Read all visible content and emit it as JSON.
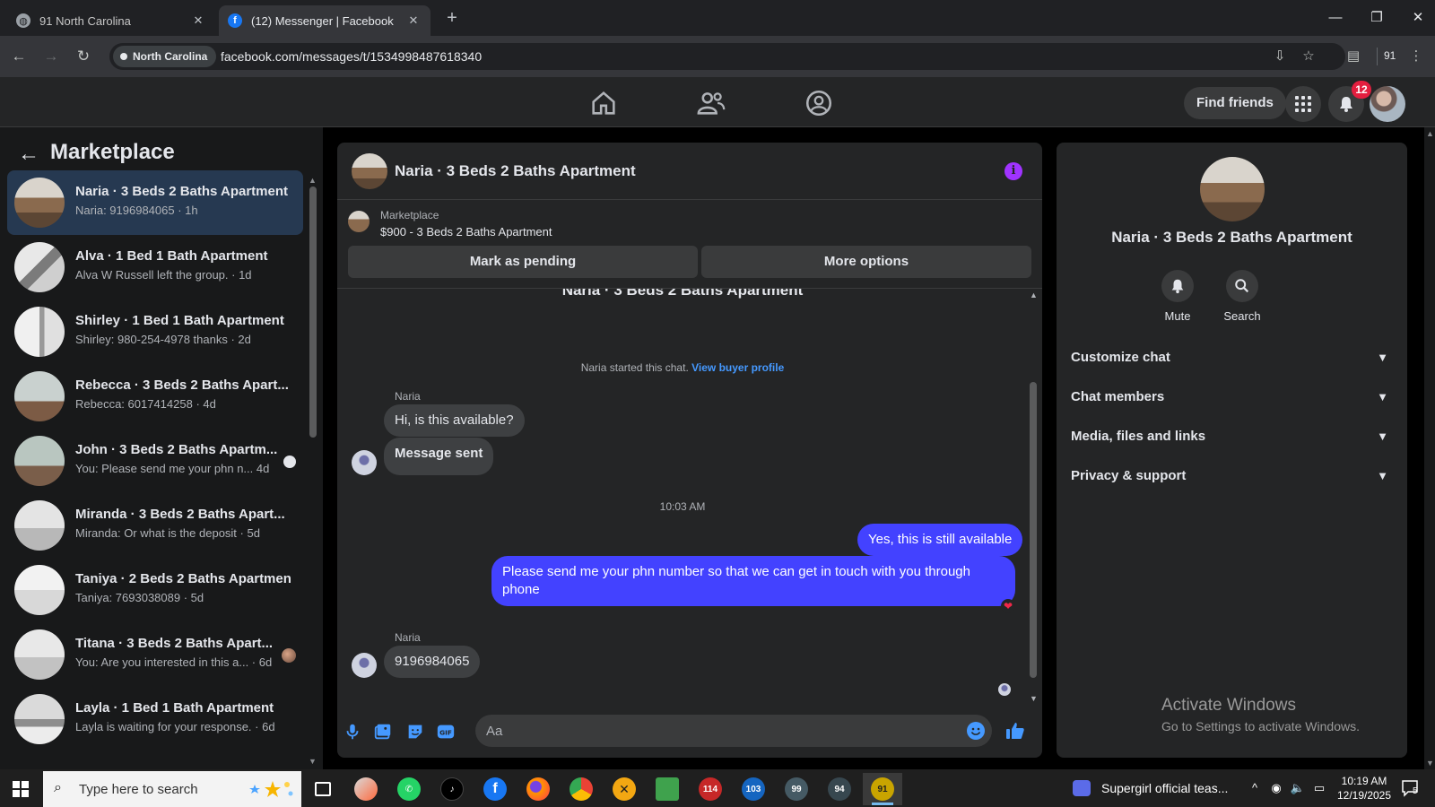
{
  "browser": {
    "tabs": [
      {
        "title": "91 North Carolina",
        "favicon": "globe-icon",
        "active": false
      },
      {
        "title": "(12) Messenger | Facebook",
        "favicon": "facebook-icon",
        "active": true
      }
    ],
    "profile_chip": "North Carolina",
    "url": "facebook.com/messages/t/1534998487618340",
    "toolbar_count": "91"
  },
  "header": {
    "find_friends": "Find friends",
    "notification_count": "12"
  },
  "marketplace": {
    "title": "Marketplace",
    "chats": [
      {
        "name": "Naria · 3 Beds 2 Baths Apartment",
        "preview": "Naria: 9196984065 · 1h",
        "active": true
      },
      {
        "name": "Alva · 1 Bed 1 Bath Apartment",
        "preview": "Alva W Russell left the group. · 1d"
      },
      {
        "name": "Shirley · 1 Bed 1 Bath Apartment",
        "preview": "Shirley: 980-254-4978 thanks · 2d"
      },
      {
        "name": "Rebecca · 3 Beds 2 Baths Apart...",
        "preview": "Rebecca: 6017414258 · 4d"
      },
      {
        "name": "John · 3 Beds 2 Baths Apartm...",
        "preview": "You: Please send me your phn n...   4d",
        "read_indicator": "white"
      },
      {
        "name": "Miranda · 3 Beds 2 Baths Apart...",
        "preview": "Miranda: Or what is the deposit · 5d"
      },
      {
        "name": "Taniya · 2 Beds 2 Baths Apartment",
        "preview": "Taniya: 7693038089 · 5d"
      },
      {
        "name": "Titana · 3 Beds 2 Baths Apart...",
        "preview": "You: Are you interested in this a...  · 6d",
        "read_indicator": "avatar"
      },
      {
        "name": "Layla · 1 Bed 1 Bath Apartment",
        "preview": "Layla is waiting for your response. · 6d"
      }
    ]
  },
  "conversation": {
    "title": "Naria · 3 Beds 2 Baths Apartment",
    "marketplace_label": "Marketplace",
    "listing": "$900 - 3 Beds 2 Baths Apartment",
    "buttons": {
      "pending": "Mark as pending",
      "more": "More options"
    },
    "cut_title": "Naria · 3 Beds 2 Baths Apartment",
    "system_message": "Naria started this chat.",
    "system_link": "View buyer profile",
    "sender": "Naria",
    "messages": {
      "in1": "Hi, is this available?",
      "in2": "Message sent",
      "time": "10:03 AM",
      "out1": "Yes, this is still available",
      "out2": "Please send me your phn number so that we can get in touch with you through phone",
      "in3": "9196984065"
    },
    "composer_placeholder": "Aa"
  },
  "info_panel": {
    "name": "Naria · 3 Beds 2 Baths Apartment",
    "actions": {
      "mute": "Mute",
      "search": "Search"
    },
    "sections": [
      "Customize chat",
      "Chat members",
      "Media, files and links",
      "Privacy & support"
    ]
  },
  "watermark": {
    "line1": "Activate Windows",
    "line2": "Go to Settings to activate Windows."
  },
  "taskbar": {
    "search_placeholder": "Type here to search",
    "apps": [
      {
        "name": "task-view",
        "badge": ""
      },
      {
        "name": "cloud-app",
        "badge": ""
      },
      {
        "name": "whatsapp",
        "badge": ""
      },
      {
        "name": "tiktok",
        "badge": ""
      },
      {
        "name": "facebook",
        "badge": ""
      },
      {
        "name": "firefox",
        "badge": ""
      },
      {
        "name": "chrome",
        "badge": ""
      },
      {
        "name": "app-x",
        "badge": ""
      },
      {
        "name": "notepad",
        "badge": ""
      },
      {
        "name": "chrome-profile-114",
        "badge": "114"
      },
      {
        "name": "chrome-profile-103",
        "badge": "103"
      },
      {
        "name": "chrome-profile-99",
        "badge": "99"
      },
      {
        "name": "chrome-profile-94",
        "badge": "94"
      },
      {
        "name": "chrome-profile-91",
        "badge": "91"
      }
    ],
    "news": "Supergirl official teas...",
    "time": "10:19 AM",
    "date": "12/19/2025",
    "notifications": "5"
  },
  "colors": {
    "accent": "#4342ff",
    "link": "#4599ff",
    "info": "#a033ff",
    "badge": "#e41e3f",
    "panel": "#242526",
    "sidebar": "#18191a",
    "selected": "#263951"
  }
}
